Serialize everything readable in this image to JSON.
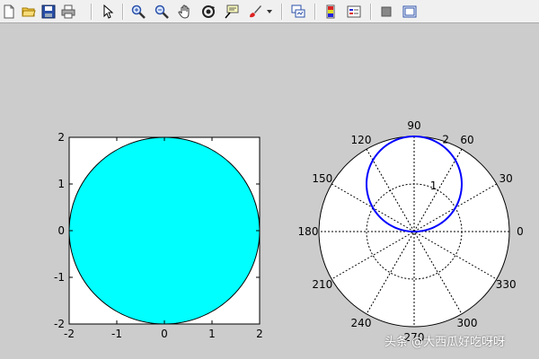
{
  "toolbar": {
    "buttons": [
      {
        "name": "new-figure-button",
        "icon": "new-file-icon"
      },
      {
        "name": "open-file-button",
        "icon": "folder-open-icon"
      },
      {
        "name": "save-figure-button",
        "icon": "save-disk-icon"
      },
      {
        "name": "print-figure-button",
        "icon": "printer-icon"
      },
      {
        "name": "edit-plot-button",
        "icon": "pointer-arrow-icon"
      },
      {
        "name": "zoom-in-button",
        "icon": "zoom-in-icon"
      },
      {
        "name": "zoom-out-button",
        "icon": "zoom-out-icon"
      },
      {
        "name": "pan-button",
        "icon": "hand-icon"
      },
      {
        "name": "rotate-3d-button",
        "icon": "rotate-icon"
      },
      {
        "name": "data-cursor-button",
        "icon": "data-cursor-icon"
      },
      {
        "name": "brush-button",
        "icon": "brush-icon"
      },
      {
        "name": "link-plot-button",
        "icon": "link-plot-icon"
      },
      {
        "name": "colorbar-button",
        "icon": "colorbar-icon"
      },
      {
        "name": "legend-button",
        "icon": "legend-icon"
      },
      {
        "name": "hide-plot-tools-button",
        "icon": "hide-tools-icon"
      },
      {
        "name": "show-plot-tools-button",
        "icon": "show-tools-icon"
      }
    ]
  },
  "chart_data": [
    {
      "type": "area",
      "shape": "circle",
      "fill_color": "#00ffff",
      "edge_color": "#000000",
      "center": [
        0,
        0
      ],
      "radius": 2,
      "xlim": [
        -2,
        2
      ],
      "ylim": [
        -2,
        2
      ],
      "xticks": [
        "-2",
        "-1",
        "0",
        "1",
        "2"
      ],
      "yticks": [
        "2",
        "1",
        "0",
        "-1",
        "-2"
      ],
      "grid": false
    },
    {
      "type": "line",
      "coordinate_system": "polar",
      "equation": "r = 2*sin(theta)",
      "line_color": "#0000ff",
      "rmax": 2,
      "rticks": [
        "1",
        "2"
      ],
      "angle_labels": [
        "0",
        "30",
        "60",
        "90",
        "120",
        "150",
        "180",
        "210",
        "240",
        "270",
        "300",
        "330"
      ],
      "grid": true
    }
  ],
  "watermark": {
    "text": "头条 @大西瓜好吃呀呀"
  }
}
